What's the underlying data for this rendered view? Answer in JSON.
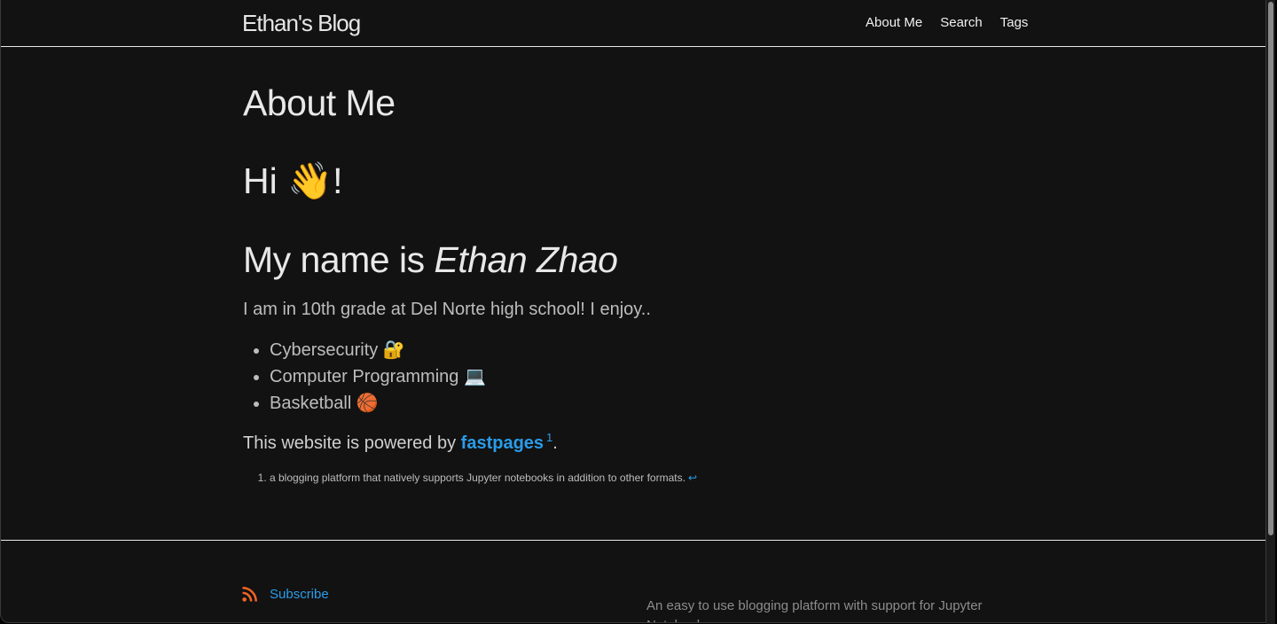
{
  "header": {
    "site_title": "Ethan's Blog",
    "nav": [
      {
        "label": "About Me"
      },
      {
        "label": "Search"
      },
      {
        "label": "Tags"
      }
    ]
  },
  "page": {
    "title": "About Me",
    "greeting": "Hi 👋!",
    "name_prefix": "My name is ",
    "name": "Ethan Zhao",
    "intro": "I am in 10th grade at Del Norte high school! I enjoy..",
    "interests": [
      {
        "label": "Cybersecurity 🔐"
      },
      {
        "label": "Computer Programming 💻"
      },
      {
        "label": "Basketball 🏀"
      }
    ],
    "powered_prefix": "This website is powered by ",
    "powered_link": "fastpages",
    "powered_footnote_ref": "1",
    "powered_suffix": ".",
    "footnote_text": "a blogging platform that natively supports Jupyter notebooks in addition to other formats.",
    "footnote_backref": "↩"
  },
  "footer": {
    "subscribe_label": "Subscribe",
    "rss_icon": "rss-icon",
    "description": "An easy to use blogging platform with support for Jupyter Notebooks."
  },
  "colors": {
    "background": "#121212",
    "link": "#2a9ce8",
    "rss": "#f26522"
  }
}
